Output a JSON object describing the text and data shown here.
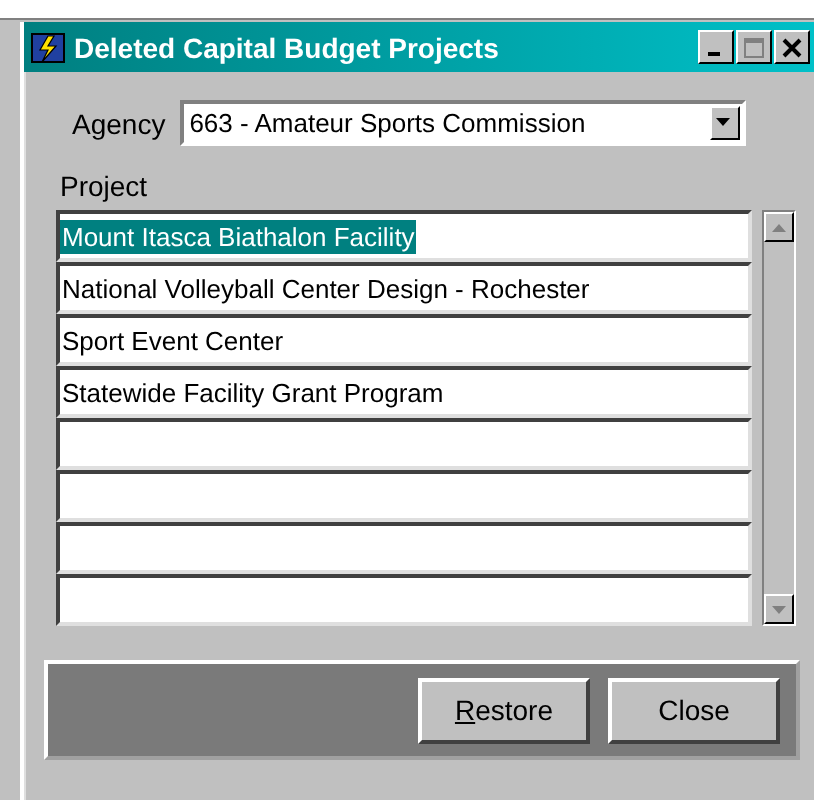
{
  "window": {
    "title": "Deleted Capital Budget Projects"
  },
  "agency": {
    "label": "Agency",
    "value": "663 - Amateur Sports Commission"
  },
  "projects": {
    "label": "Project",
    "rows": [
      {
        "name": "Mount Itasca Biathalon Facility",
        "selected": true
      },
      {
        "name": "National Volleyball Center Design - Rochester",
        "selected": false
      },
      {
        "name": "Sport Event Center",
        "selected": false
      },
      {
        "name": "Statewide Facility Grant Program",
        "selected": false
      }
    ]
  },
  "buttons": [
    {
      "label": "Restore",
      "access_key_underlined": true
    },
    {
      "label": "Close",
      "access_key_underlined": false
    }
  ]
}
